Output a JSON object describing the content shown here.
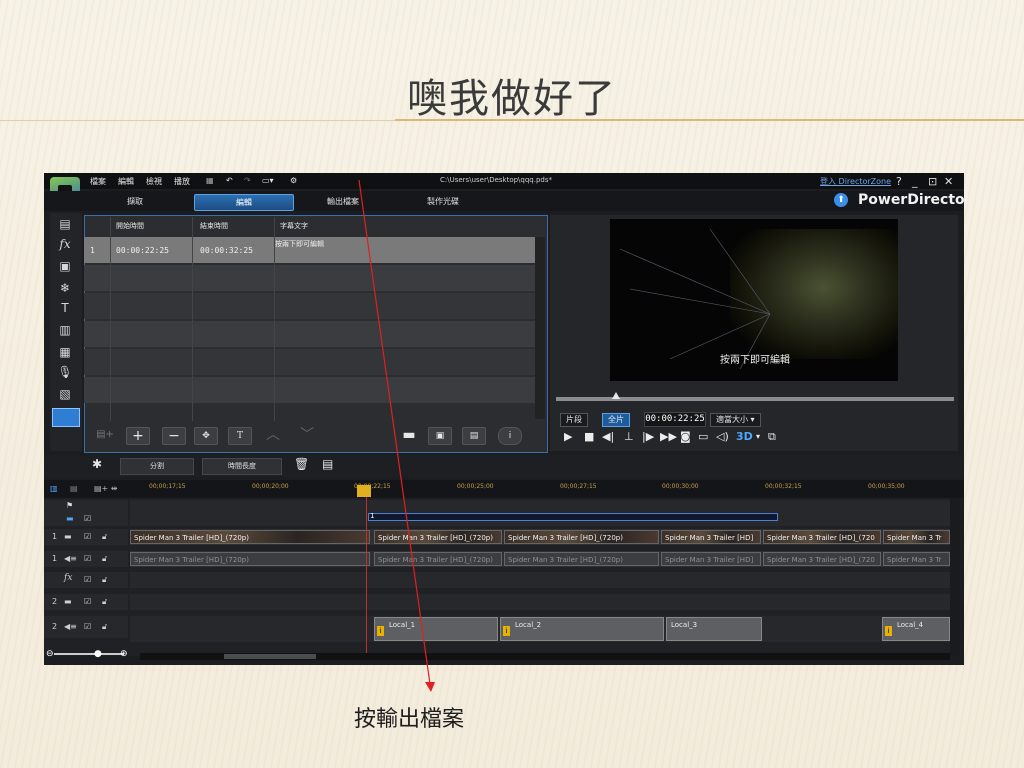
{
  "slide": {
    "title": "噢我做好了",
    "caption": "按輸出檔案"
  },
  "app": {
    "menu": [
      "檔案",
      "編輯",
      "檢視",
      "播放"
    ],
    "file_path": "C:\\Users\\user\\Desktop\\qqq.pds*",
    "login": "登入 DirectorZone",
    "window_buttons": [
      "?",
      "_",
      "⊡",
      "✕"
    ],
    "tabs": [
      "擷取",
      "編輯",
      "輸出檔案",
      "製作光碟"
    ],
    "active_tab": "編輯",
    "brand": "PowerDirector",
    "colors": {
      "accent": "#2c6fb1",
      "background": "#1b1d20",
      "playhead": "#c0302b",
      "arrow": "#e02020"
    }
  },
  "subtitle_room": {
    "columns": [
      "開始時間",
      "結束時間",
      "字幕文字"
    ],
    "rows": [
      {
        "index": "1",
        "start": "00:00:22:25",
        "end": "00:00:32:25",
        "text": "按兩下即可編輯"
      }
    ]
  },
  "preview": {
    "caption": "按兩下即可編輯",
    "mode_label": "片段",
    "mode_selected": "全片",
    "timecode": "00:00:22:25",
    "fit_label": "適當大小",
    "threed_label": "3D"
  },
  "timeline_toolbar": {
    "split_label": "分割",
    "duration_label": "時間長度"
  },
  "ruler": [
    "00;00;17;15",
    "00;00;20;00",
    "00;00;22;15",
    "00;00;25;00",
    "00;00;27;15",
    "00;00;30;00",
    "00;00;32;15",
    "00;00;35;00"
  ],
  "video_clips": [
    "Spider Man 3 Trailer [HD]_(720p)",
    "Spider Man 3 Trailer [HD]_(720p)",
    "Spider Man 3 Trailer [HD]_(720p)",
    "Spider Man 3 Trailer [HD]",
    "Spider Man 3 Trailer [HD]_(720",
    "Spider Man 3 Tr"
  ],
  "audio_clips": [
    "Spider Man 3 Trailer [HD]_(720p)",
    "Spider Man 3 Trailer [HD]_(720p)",
    "Spider Man 3 Trailer [HD]_(720p)",
    "Spider Man 3 Trailer [HD]",
    "Spider Man 3 Trailer [HD]_(720",
    "Spider Man 3 Tr"
  ],
  "sound_clips": [
    "Local_1",
    "Local_2",
    "Local_3",
    "Local_4"
  ],
  "range_marker": "1",
  "track_labels": [
    "1",
    "1",
    "fx",
    "2",
    "2"
  ]
}
